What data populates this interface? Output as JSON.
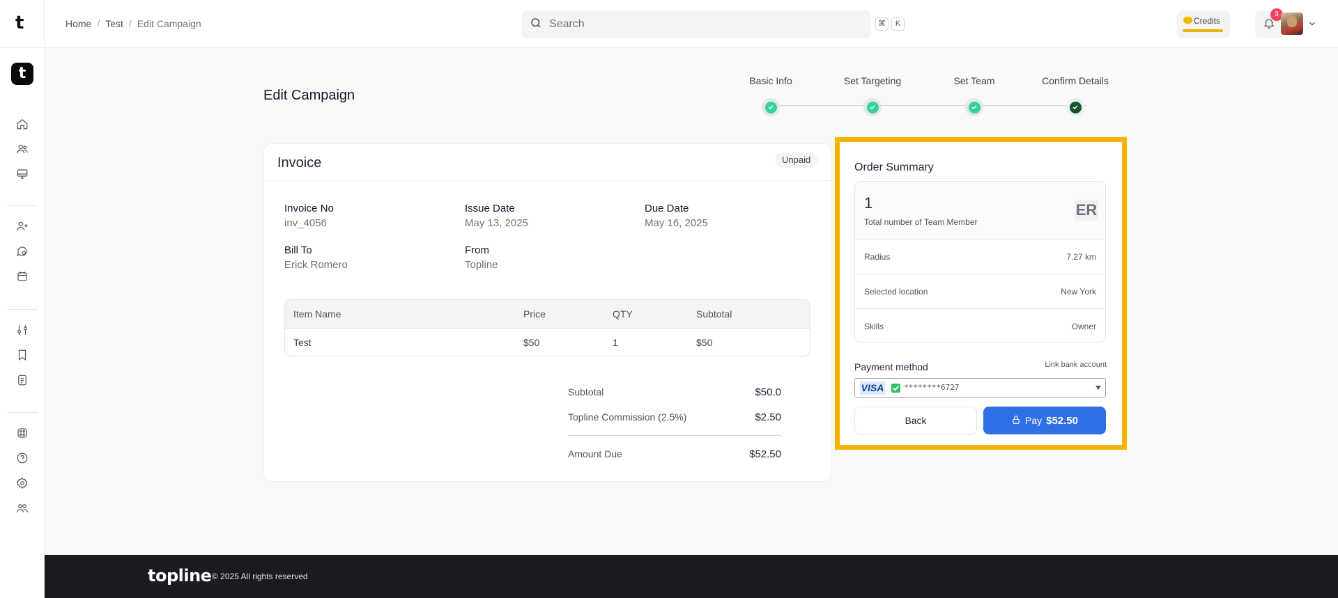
{
  "sidebar": {
    "brand": "t",
    "app_logo": "t",
    "icons": [
      "home-icon",
      "users-icon",
      "monitor-icon",
      "user-plus-icon",
      "chat-icon",
      "calendar-icon",
      "sliders-icon",
      "bookmark-icon",
      "document-icon",
      "apps-icon",
      "help-icon",
      "settings-icon",
      "team-icon"
    ]
  },
  "topbar": {
    "breadcrumb": [
      "Home",
      "Test",
      "Edit Campaign"
    ],
    "breadcrumb_sep": "/",
    "search_placeholder": "Search",
    "shortcut_keys": [
      "⌘",
      "K"
    ],
    "credits_label": "Credits",
    "notifications_count": "3"
  },
  "page": {
    "title": "Edit Campaign",
    "steps": [
      {
        "label": "Basic Info",
        "status": "done"
      },
      {
        "label": "Set Targeting",
        "status": "done"
      },
      {
        "label": "Set Team",
        "status": "done"
      },
      {
        "label": "Confirm Details",
        "status": "current"
      }
    ]
  },
  "invoice": {
    "title": "Invoice",
    "status": "Unpaid",
    "invoice_no_label": "Invoice No",
    "invoice_no": "inv_4056",
    "issue_date_label": "Issue Date",
    "issue_date": "May 13, 2025",
    "due_date_label": "Due Date",
    "due_date": "May 16, 2025",
    "bill_to_label": "Bill To",
    "bill_to": "Erick Romero",
    "from_label": "From",
    "from": "Topline",
    "columns": [
      "Item Name",
      "Price",
      "QTY",
      "Subtotal"
    ],
    "rows": [
      {
        "name": "Test",
        "price": "$50",
        "qty": "1",
        "subtotal": "$50"
      }
    ],
    "subtotal_label": "Subtotal",
    "subtotal": "$50.0",
    "commission_label": "Topline Commission (2.5%)",
    "commission": "$2.50",
    "amount_due_label": "Amount Due",
    "amount_due": "$52.50"
  },
  "summary": {
    "title": "Order Summary",
    "team_count": "1",
    "team_count_label": "Total number of Team Member",
    "initials": "ER",
    "rows": [
      {
        "label": "Radius",
        "value": "7.27 km"
      },
      {
        "label": "Selected location",
        "value": "New York"
      },
      {
        "label": "Skills",
        "value": "Owner"
      }
    ],
    "payment_method_label": "Payment method",
    "link_bank_label": "Link bank account",
    "card_brand": "VISA",
    "card_number": "********6727",
    "back_label": "Back",
    "pay_label": "Pay",
    "pay_amount": "$52.50"
  },
  "footer": {
    "logo": "topline",
    "copyright": "© 2025 All rights reserved"
  },
  "colors": {
    "highlight": "#f4b400",
    "primary": "#2f6fe8",
    "success": "#34d399"
  }
}
